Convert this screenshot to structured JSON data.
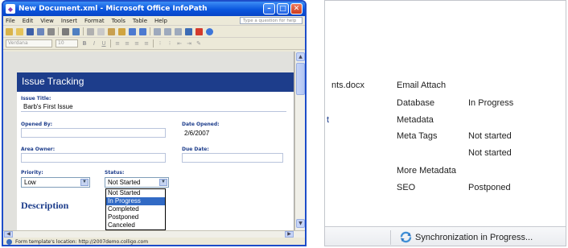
{
  "infopath": {
    "window_title": "New Document.xml - Microsoft Office InfoPath",
    "menu": [
      "File",
      "Edit",
      "View",
      "Insert",
      "Format",
      "Tools",
      "Table",
      "Help"
    ],
    "help_placeholder": "Type a question for help",
    "font_name": "Verdana",
    "font_size": "10",
    "form": {
      "header": "Issue Tracking",
      "issue_title_label": "Issue Title:",
      "issue_title_value": "Barb's First Issue",
      "opened_by_label": "Opened By:",
      "opened_by_value": "",
      "date_opened_label": "Date Opened:",
      "date_opened_value": "2/6/2007",
      "area_owner_label": "Area Owner:",
      "area_owner_value": "",
      "due_date_label": "Due Date:",
      "due_date_value": "",
      "priority_label": "Priority:",
      "priority_value": "Low",
      "status_label": "Status:",
      "status_value": "Not Started",
      "status_options": [
        "Not Started",
        "In Progress",
        "Completed",
        "Postponed",
        "Canceled"
      ],
      "status_highlighted": "In Progress",
      "description_heading": "Description"
    },
    "statusbar": "Form template's location: http://2007demo.colligo.com"
  },
  "sharepoint": {
    "rows": [
      {
        "name": "nts.docx",
        "task": "Email Attach",
        "status": ""
      },
      {
        "name": "",
        "task": "Database",
        "status": "In Progress"
      },
      {
        "name": "",
        "task": "Metadata",
        "status": ""
      },
      {
        "name": "",
        "task": "Meta Tags",
        "status": "Not started"
      },
      {
        "name": "",
        "task": "",
        "status": "Not started"
      },
      {
        "name": "",
        "task": "More Metadata",
        "status": ""
      },
      {
        "name": "",
        "task": "SEO",
        "status": "Postponed"
      }
    ],
    "sync_status": "Synchronization in Progress..."
  },
  "colors": {
    "form_header": "#1d3d8b",
    "titlebar": "#0a56de",
    "selection": "#316ac5"
  }
}
